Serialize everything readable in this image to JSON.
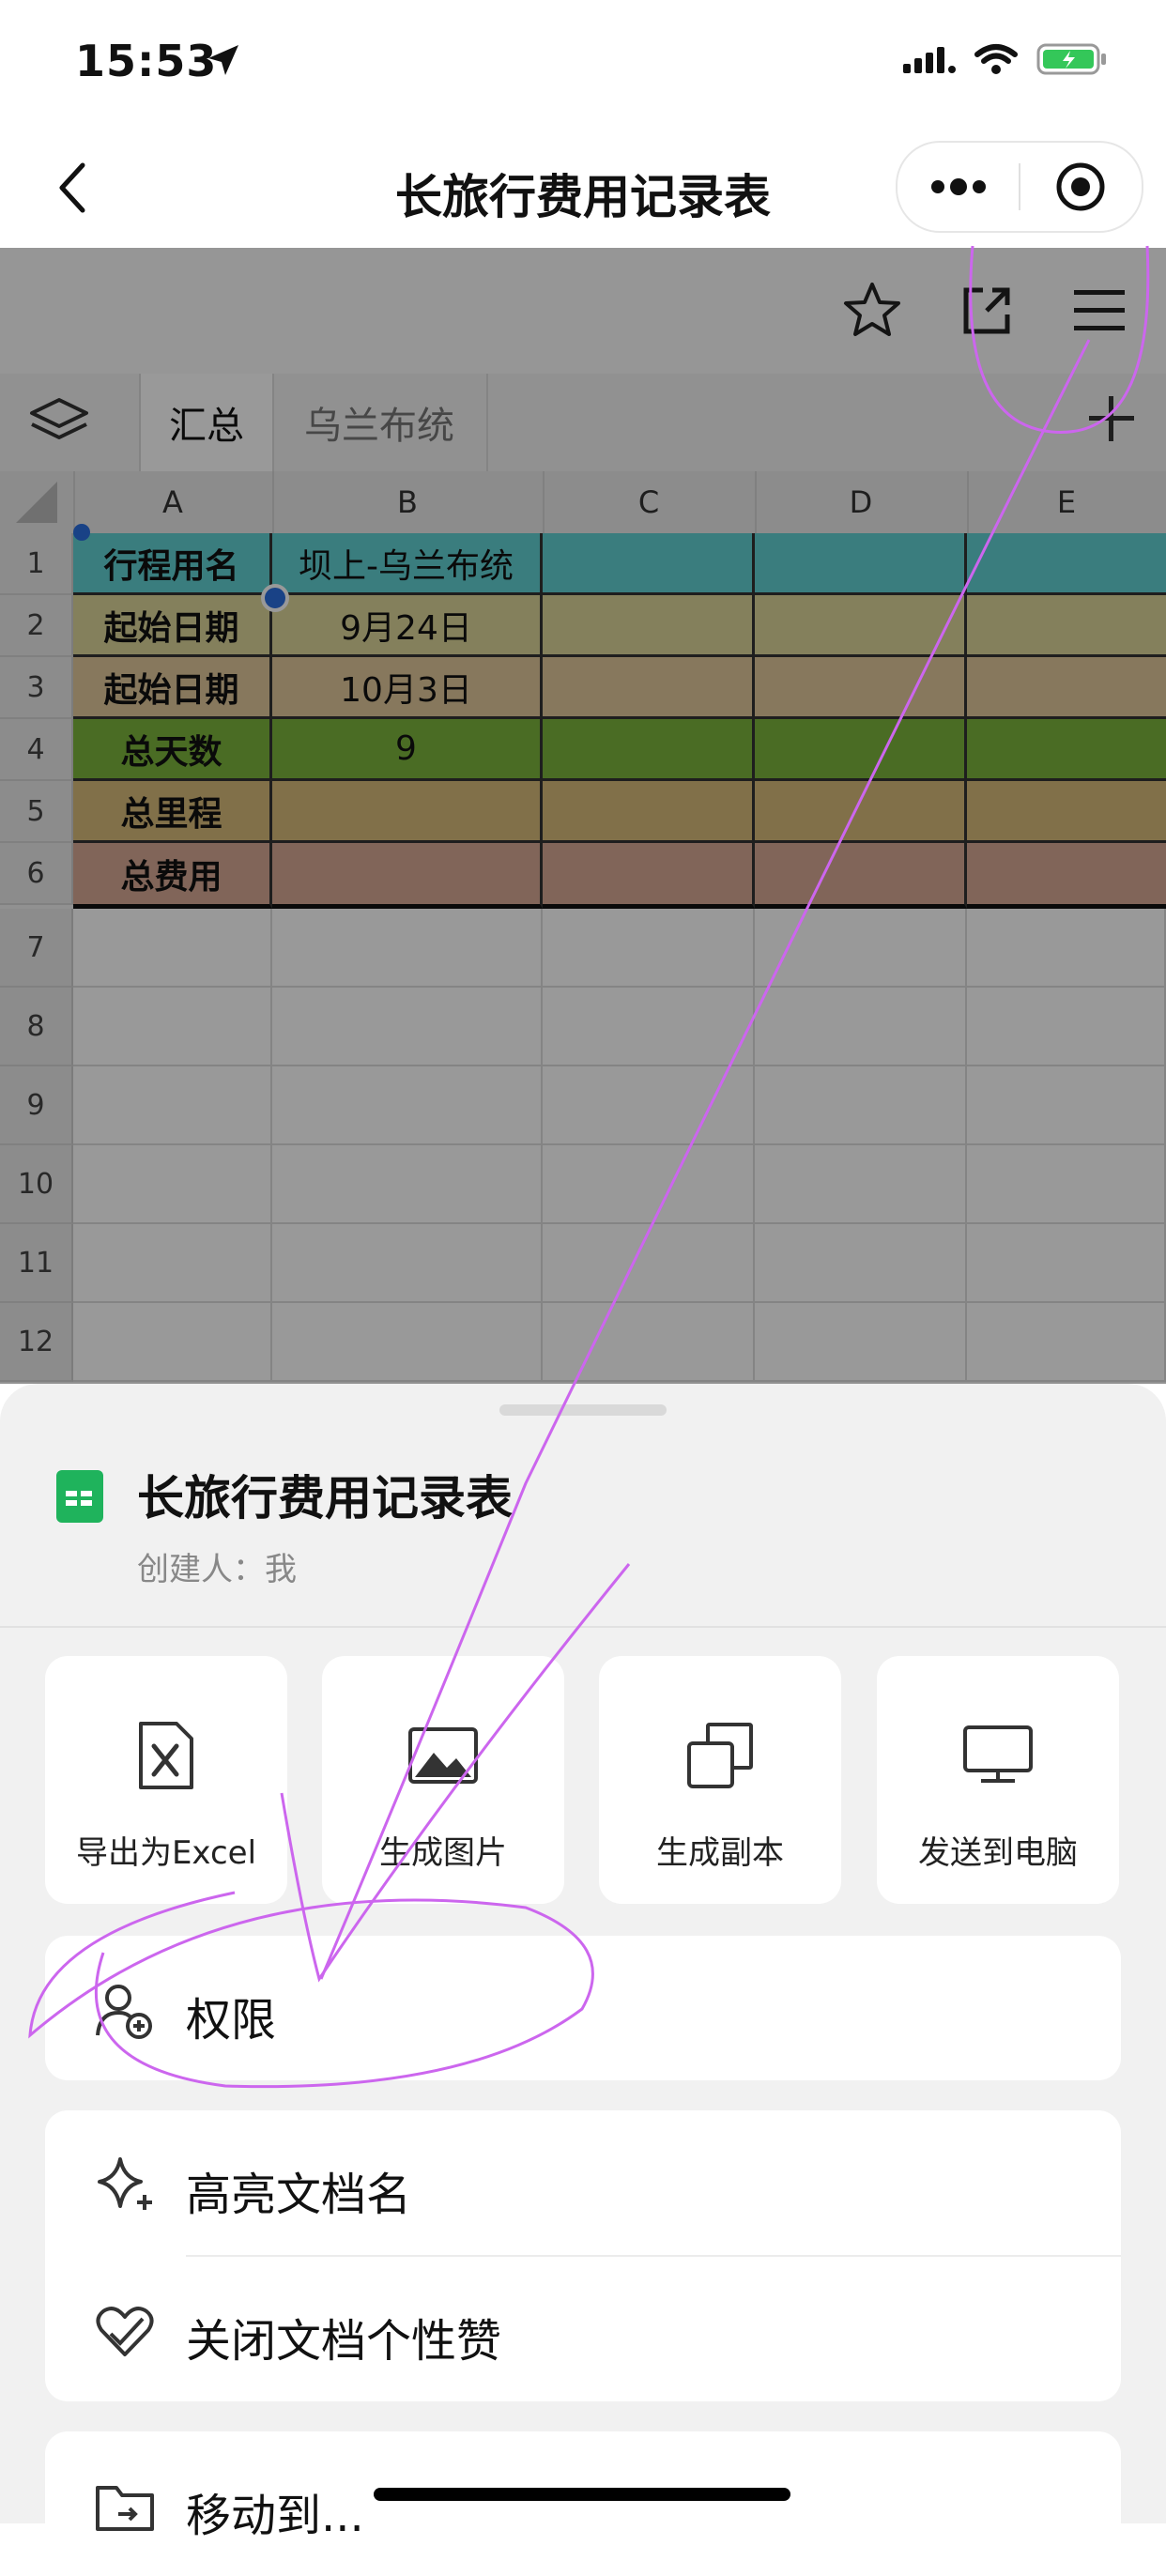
{
  "status_bar": {
    "time": "15:53"
  },
  "nav": {
    "title": "长旅行费用记录表"
  },
  "sheet_tabs": [
    "汇总",
    "乌兰布统"
  ],
  "columns": [
    "A",
    "B",
    "C",
    "D",
    "E"
  ],
  "row_numbers": [
    "1",
    "2",
    "3",
    "4",
    "5",
    "6",
    "7",
    "8",
    "9",
    "10",
    "11",
    "12"
  ],
  "table": [
    {
      "label": "行程用名",
      "value": "坝上-乌兰布统",
      "color": "#4a9e9f"
    },
    {
      "label": "起始日期",
      "value": "9月24日",
      "color": "#a3a06a"
    },
    {
      "label": "起始日期",
      "value": "10月3日",
      "color": "#a8946a"
    },
    {
      "label": "总天数",
      "value": "9",
      "color": "#547a2a"
    },
    {
      "label": "总里程",
      "value": "",
      "color": "#9c8a56"
    },
    {
      "label": "总费用",
      "value": "",
      "color": "#9b7a6a"
    }
  ],
  "bottom_sheet": {
    "doc_title": "长旅行费用记录表",
    "creator": "创建人：我",
    "actions": [
      "导出为Excel",
      "生成图片",
      "生成副本",
      "发送到电脑"
    ],
    "permissions": "权限",
    "highlight": "高亮文档名",
    "close_like": "关闭文档个性赞",
    "move_to": "移动到..."
  }
}
